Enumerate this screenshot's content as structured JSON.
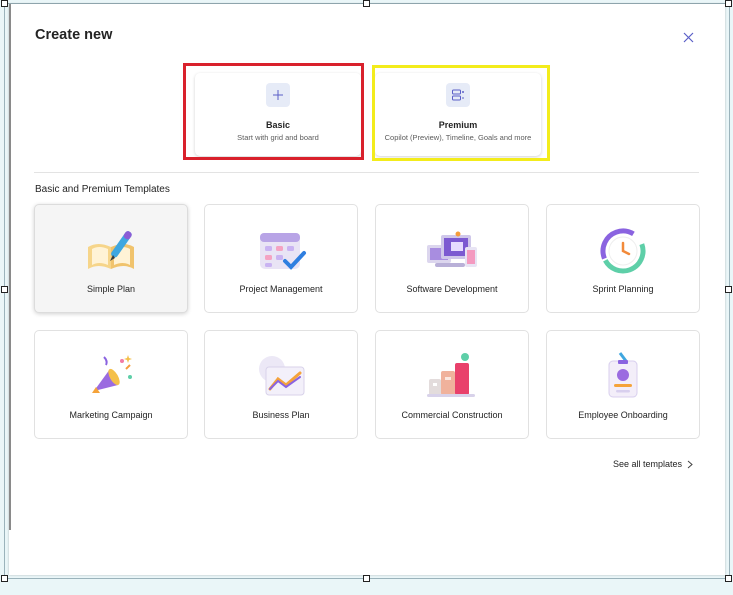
{
  "dialog": {
    "title": "Create new",
    "close_icon": "close-icon"
  },
  "plan_types": [
    {
      "name": "Basic",
      "description": "Start with grid and board",
      "icon": "plus-icon"
    },
    {
      "name": "Premium",
      "description": "Copilot (Preview), Timeline, Goals and more",
      "icon": "premium-plan-icon"
    }
  ],
  "templates_section": {
    "heading": "Basic and Premium Templates",
    "items": [
      {
        "label": "Simple Plan",
        "icon": "notebook-pen-icon"
      },
      {
        "label": "Project Management",
        "icon": "calendar-check-icon"
      },
      {
        "label": "Software Development",
        "icon": "devices-icon"
      },
      {
        "label": "Sprint Planning",
        "icon": "clock-cycle-icon"
      },
      {
        "label": "Marketing Campaign",
        "icon": "megaphone-icon"
      },
      {
        "label": "Business Plan",
        "icon": "trend-chart-icon"
      },
      {
        "label": "Commercial Construction",
        "icon": "buildings-icon"
      },
      {
        "label": "Employee Onboarding",
        "icon": "id-badge-icon"
      }
    ]
  },
  "footer": {
    "see_all_label": "See all templates"
  },
  "colors": {
    "highlight_red": "#d9212c",
    "highlight_yellow": "#f3ec1b",
    "accent": "#5b5fc7"
  }
}
